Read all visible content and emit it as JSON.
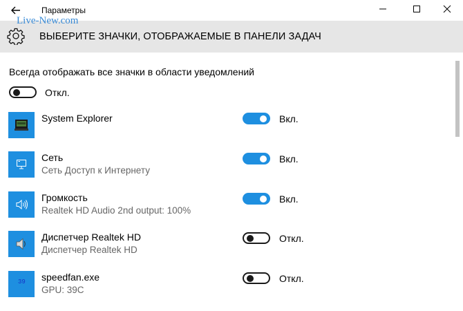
{
  "window": {
    "title": "Параметры",
    "watermark": "Live-New.com"
  },
  "header": {
    "title": "ВЫБЕРИТЕ ЗНАЧКИ, ОТОБРАЖАЕМЫЕ В ПАНЕЛИ ЗАДАЧ"
  },
  "master": {
    "label": "Всегда отображать все значки в области уведомлений",
    "state": "Откл.",
    "on": false
  },
  "apps": [
    {
      "name": "System Explorer",
      "sub": "",
      "state": "Вкл.",
      "on": true,
      "icon": "system-explorer-icon"
    },
    {
      "name": "Сеть",
      "sub": "Сеть Доступ к Интернету",
      "state": "Вкл.",
      "on": true,
      "icon": "network-icon"
    },
    {
      "name": "Громкость",
      "sub": "Realtek HD Audio 2nd output: 100%",
      "state": "Вкл.",
      "on": true,
      "icon": "volume-icon"
    },
    {
      "name": "Диспетчер Realtek HD",
      "sub": "Диспетчер Realtek HD",
      "state": "Откл.",
      "on": false,
      "icon": "realtek-speaker-icon"
    },
    {
      "name": "speedfan.exe",
      "sub": "GPU: 39C",
      "state": "Откл.",
      "on": false,
      "icon": "speedfan-icon",
      "icon_text": "39"
    }
  ],
  "colors": {
    "accent": "#1e8fe0",
    "header_bg": "#e6e6e6"
  }
}
